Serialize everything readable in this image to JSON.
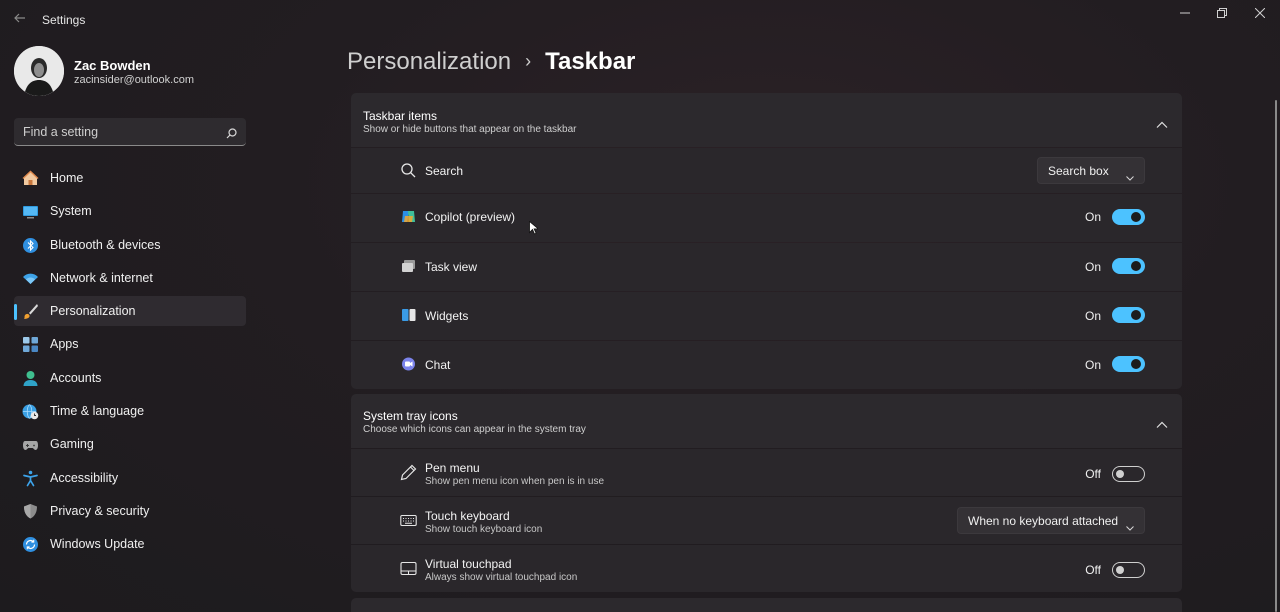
{
  "window": {
    "title": "Settings",
    "back_icon": "back-arrow-icon",
    "controls": [
      "minimize-icon",
      "restore-icon",
      "close-icon"
    ]
  },
  "profile": {
    "name": "Zac Bowden",
    "email": "zacinsider@outlook.com"
  },
  "search": {
    "placeholder": "Find a setting",
    "value": ""
  },
  "nav": {
    "items": [
      {
        "label": "Home",
        "icon": "home-icon"
      },
      {
        "label": "System",
        "icon": "monitor-icon"
      },
      {
        "label": "Bluetooth & devices",
        "icon": "bluetooth-icon"
      },
      {
        "label": "Network & internet",
        "icon": "wifi-icon"
      },
      {
        "label": "Personalization",
        "icon": "paintbrush-icon",
        "active": true
      },
      {
        "label": "Apps",
        "icon": "apps-icon"
      },
      {
        "label": "Accounts",
        "icon": "person-icon"
      },
      {
        "label": "Time & language",
        "icon": "globe-clock-icon"
      },
      {
        "label": "Gaming",
        "icon": "gamepad-icon"
      },
      {
        "label": "Accessibility",
        "icon": "accessibility-icon"
      },
      {
        "label": "Privacy & security",
        "icon": "shield-icon"
      },
      {
        "label": "Windows Update",
        "icon": "update-icon"
      }
    ]
  },
  "header": {
    "parent": "Personalization",
    "separator": "›",
    "current": "Taskbar"
  },
  "taskbar_items": {
    "title": "Taskbar items",
    "subtitle": "Show or hide buttons that appear on the taskbar",
    "rows": [
      {
        "label": "Search",
        "icon": "search-icon",
        "control": "dropdown",
        "value": "Search box"
      },
      {
        "label": "Copilot (preview)",
        "icon": "copilot-icon",
        "control": "toggle",
        "state": "On",
        "on": true
      },
      {
        "label": "Task view",
        "icon": "task-view-icon",
        "control": "toggle",
        "state": "On",
        "on": true
      },
      {
        "label": "Widgets",
        "icon": "widgets-icon",
        "control": "toggle",
        "state": "On",
        "on": true
      },
      {
        "label": "Chat",
        "icon": "chat-icon",
        "control": "toggle",
        "state": "On",
        "on": true
      }
    ]
  },
  "system_tray": {
    "title": "System tray icons",
    "subtitle": "Choose which icons can appear in the system tray",
    "rows": [
      {
        "label": "Pen menu",
        "sub": "Show pen menu icon when pen is in use",
        "icon": "pen-icon",
        "control": "toggle",
        "state": "Off",
        "on": false
      },
      {
        "label": "Touch keyboard",
        "sub": "Show touch keyboard icon",
        "icon": "keyboard-icon",
        "control": "dropdown",
        "value": "When no keyboard attached"
      },
      {
        "label": "Virtual touchpad",
        "sub": "Always show virtual touchpad icon",
        "icon": "touchpad-icon",
        "control": "toggle",
        "state": "Off",
        "on": false
      }
    ]
  },
  "colors": {
    "accent": "#4cc2ff",
    "background": "#221d21",
    "card": "#2a272b"
  }
}
